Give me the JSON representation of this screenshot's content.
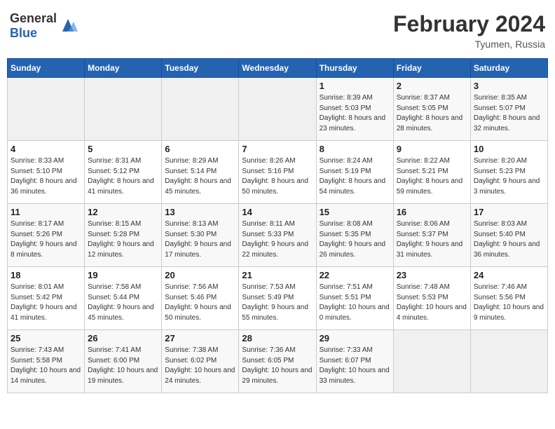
{
  "header": {
    "logo_general": "General",
    "logo_blue": "Blue",
    "title": "February 2024",
    "location": "Tyumen, Russia"
  },
  "weekdays": [
    "Sunday",
    "Monday",
    "Tuesday",
    "Wednesday",
    "Thursday",
    "Friday",
    "Saturday"
  ],
  "weeks": [
    [
      {
        "day": "",
        "empty": true
      },
      {
        "day": "",
        "empty": true
      },
      {
        "day": "",
        "empty": true
      },
      {
        "day": "",
        "empty": true
      },
      {
        "day": "1",
        "sunrise": "Sunrise: 8:39 AM",
        "sunset": "Sunset: 5:03 PM",
        "daylight": "Daylight: 8 hours and 23 minutes."
      },
      {
        "day": "2",
        "sunrise": "Sunrise: 8:37 AM",
        "sunset": "Sunset: 5:05 PM",
        "daylight": "Daylight: 8 hours and 28 minutes."
      },
      {
        "day": "3",
        "sunrise": "Sunrise: 8:35 AM",
        "sunset": "Sunset: 5:07 PM",
        "daylight": "Daylight: 8 hours and 32 minutes."
      }
    ],
    [
      {
        "day": "4",
        "sunrise": "Sunrise: 8:33 AM",
        "sunset": "Sunset: 5:10 PM",
        "daylight": "Daylight: 8 hours and 36 minutes."
      },
      {
        "day": "5",
        "sunrise": "Sunrise: 8:31 AM",
        "sunset": "Sunset: 5:12 PM",
        "daylight": "Daylight: 8 hours and 41 minutes."
      },
      {
        "day": "6",
        "sunrise": "Sunrise: 8:29 AM",
        "sunset": "Sunset: 5:14 PM",
        "daylight": "Daylight: 8 hours and 45 minutes."
      },
      {
        "day": "7",
        "sunrise": "Sunrise: 8:26 AM",
        "sunset": "Sunset: 5:16 PM",
        "daylight": "Daylight: 8 hours and 50 minutes."
      },
      {
        "day": "8",
        "sunrise": "Sunrise: 8:24 AM",
        "sunset": "Sunset: 5:19 PM",
        "daylight": "Daylight: 8 hours and 54 minutes."
      },
      {
        "day": "9",
        "sunrise": "Sunrise: 8:22 AM",
        "sunset": "Sunset: 5:21 PM",
        "daylight": "Daylight: 8 hours and 59 minutes."
      },
      {
        "day": "10",
        "sunrise": "Sunrise: 8:20 AM",
        "sunset": "Sunset: 5:23 PM",
        "daylight": "Daylight: 9 hours and 3 minutes."
      }
    ],
    [
      {
        "day": "11",
        "sunrise": "Sunrise: 8:17 AM",
        "sunset": "Sunset: 5:26 PM",
        "daylight": "Daylight: 9 hours and 8 minutes."
      },
      {
        "day": "12",
        "sunrise": "Sunrise: 8:15 AM",
        "sunset": "Sunset: 5:28 PM",
        "daylight": "Daylight: 9 hours and 12 minutes."
      },
      {
        "day": "13",
        "sunrise": "Sunrise: 8:13 AM",
        "sunset": "Sunset: 5:30 PM",
        "daylight": "Daylight: 9 hours and 17 minutes."
      },
      {
        "day": "14",
        "sunrise": "Sunrise: 8:11 AM",
        "sunset": "Sunset: 5:33 PM",
        "daylight": "Daylight: 9 hours and 22 minutes."
      },
      {
        "day": "15",
        "sunrise": "Sunrise: 8:08 AM",
        "sunset": "Sunset: 5:35 PM",
        "daylight": "Daylight: 9 hours and 26 minutes."
      },
      {
        "day": "16",
        "sunrise": "Sunrise: 8:06 AM",
        "sunset": "Sunset: 5:37 PM",
        "daylight": "Daylight: 9 hours and 31 minutes."
      },
      {
        "day": "17",
        "sunrise": "Sunrise: 8:03 AM",
        "sunset": "Sunset: 5:40 PM",
        "daylight": "Daylight: 9 hours and 36 minutes."
      }
    ],
    [
      {
        "day": "18",
        "sunrise": "Sunrise: 8:01 AM",
        "sunset": "Sunset: 5:42 PM",
        "daylight": "Daylight: 9 hours and 41 minutes."
      },
      {
        "day": "19",
        "sunrise": "Sunrise: 7:58 AM",
        "sunset": "Sunset: 5:44 PM",
        "daylight": "Daylight: 9 hours and 45 minutes."
      },
      {
        "day": "20",
        "sunrise": "Sunrise: 7:56 AM",
        "sunset": "Sunset: 5:46 PM",
        "daylight": "Daylight: 9 hours and 50 minutes."
      },
      {
        "day": "21",
        "sunrise": "Sunrise: 7:53 AM",
        "sunset": "Sunset: 5:49 PM",
        "daylight": "Daylight: 9 hours and 55 minutes."
      },
      {
        "day": "22",
        "sunrise": "Sunrise: 7:51 AM",
        "sunset": "Sunset: 5:51 PM",
        "daylight": "Daylight: 10 hours and 0 minutes."
      },
      {
        "day": "23",
        "sunrise": "Sunrise: 7:48 AM",
        "sunset": "Sunset: 5:53 PM",
        "daylight": "Daylight: 10 hours and 4 minutes."
      },
      {
        "day": "24",
        "sunrise": "Sunrise: 7:46 AM",
        "sunset": "Sunset: 5:56 PM",
        "daylight": "Daylight: 10 hours and 9 minutes."
      }
    ],
    [
      {
        "day": "25",
        "sunrise": "Sunrise: 7:43 AM",
        "sunset": "Sunset: 5:58 PM",
        "daylight": "Daylight: 10 hours and 14 minutes."
      },
      {
        "day": "26",
        "sunrise": "Sunrise: 7:41 AM",
        "sunset": "Sunset: 6:00 PM",
        "daylight": "Daylight: 10 hours and 19 minutes."
      },
      {
        "day": "27",
        "sunrise": "Sunrise: 7:38 AM",
        "sunset": "Sunset: 6:02 PM",
        "daylight": "Daylight: 10 hours and 24 minutes."
      },
      {
        "day": "28",
        "sunrise": "Sunrise: 7:36 AM",
        "sunset": "Sunset: 6:05 PM",
        "daylight": "Daylight: 10 hours and 29 minutes."
      },
      {
        "day": "29",
        "sunrise": "Sunrise: 7:33 AM",
        "sunset": "Sunset: 6:07 PM",
        "daylight": "Daylight: 10 hours and 33 minutes."
      },
      {
        "day": "",
        "empty": true
      },
      {
        "day": "",
        "empty": true
      }
    ]
  ]
}
